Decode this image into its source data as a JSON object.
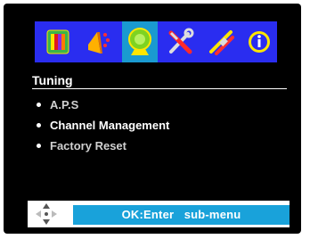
{
  "tabs": [
    {
      "name": "picture",
      "icon": "color-bars-icon",
      "selected": false
    },
    {
      "name": "sound",
      "icon": "speaker-icon",
      "selected": false
    },
    {
      "name": "tuning",
      "icon": "satellite-dish-icon",
      "selected": true
    },
    {
      "name": "setup",
      "icon": "tools-icon",
      "selected": false
    },
    {
      "name": "connection",
      "icon": "cable-plug-icon",
      "selected": false
    },
    {
      "name": "info",
      "icon": "info-icon",
      "selected": false
    }
  ],
  "menu": {
    "title": "Tuning",
    "items": [
      {
        "label": "A.P.S",
        "highlighted": false
      },
      {
        "label": "Channel Management",
        "highlighted": true
      },
      {
        "label": "Factory Reset",
        "highlighted": false
      }
    ]
  },
  "help": {
    "nav_icon": "navigation-arrows-icon",
    "text": "OK:Enter   sub-menu"
  },
  "colors": {
    "screen_background": "#000000",
    "icon_bar": "#2a2df0",
    "selected_tab": "#1a9ad0",
    "hint_background": "#19a2da",
    "text": "#ffffff"
  }
}
